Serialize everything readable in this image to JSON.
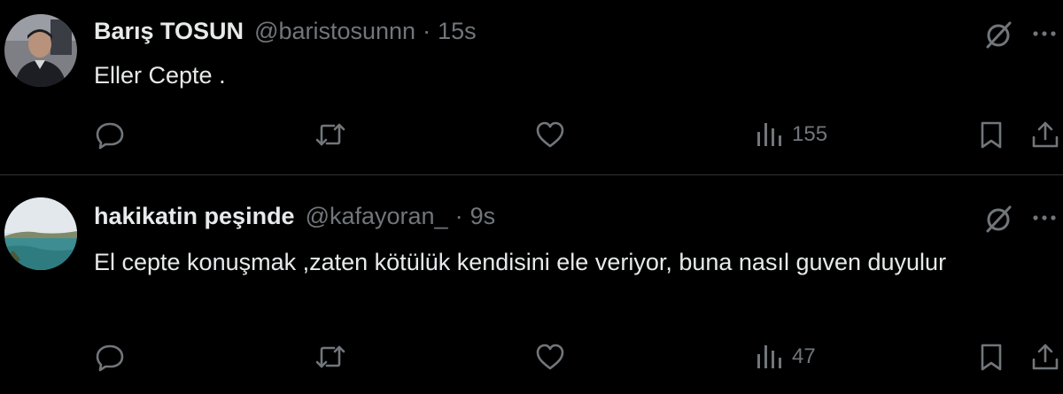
{
  "tweets": [
    {
      "name": "Barış TOSUN",
      "handle": "@baristosunnn",
      "separator": "·",
      "time": "15s",
      "text": "Eller Cepte .",
      "views": "155",
      "avatar": "person-photo"
    },
    {
      "name": "hakikatin peşinde",
      "handle": "@kafayoran_",
      "separator": "·",
      "time": "9s",
      "text": "El cepte konuşmak ,zaten kötülük kendisini ele veriyor, buna nasıl guven duyulur",
      "views": "47",
      "avatar": "lake-landscape-photo"
    }
  ],
  "icons": {
    "reply": "reply-icon",
    "retweet": "retweet-icon",
    "like": "heart-icon",
    "views": "views-icon",
    "bookmark": "bookmark-icon",
    "share": "share-icon",
    "grok": "grok-icon",
    "more": "more-icon"
  },
  "colors": {
    "background": "#000000",
    "text": "#e7e9ea",
    "secondary": "#71767b",
    "divider": "#2f3336"
  }
}
